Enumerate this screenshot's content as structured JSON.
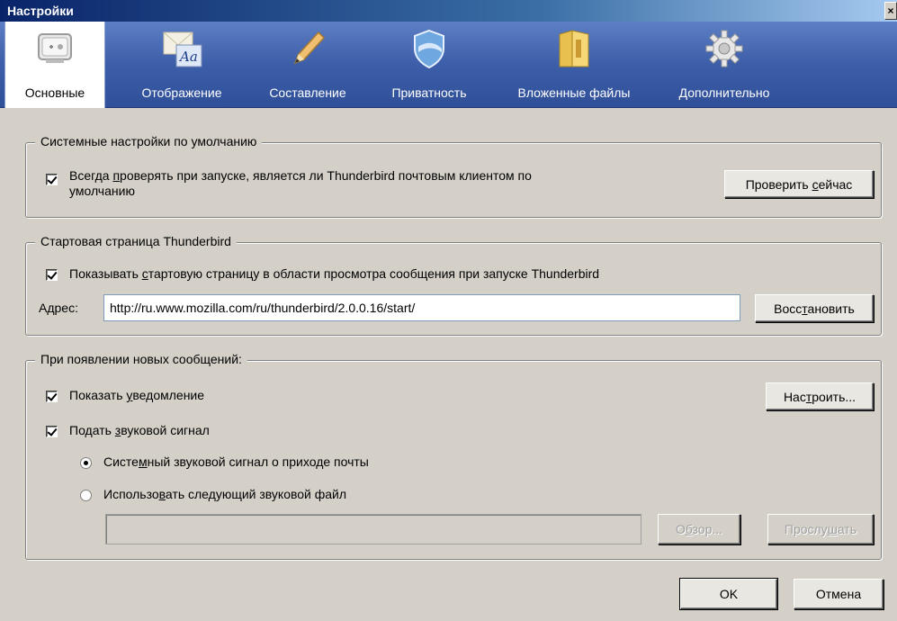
{
  "window": {
    "title": "Настройки"
  },
  "tabs": [
    {
      "label": "Основные",
      "icon": "general-icon"
    },
    {
      "label": "Отображение",
      "icon": "display-icon"
    },
    {
      "label": "Составление",
      "icon": "pencil-icon"
    },
    {
      "label": "Приватность",
      "icon": "shield-icon"
    },
    {
      "label": "Вложенные файлы",
      "icon": "folder-icon"
    },
    {
      "label": "Дополнительно",
      "icon": "gear-icon"
    }
  ],
  "default_system": {
    "legend": "Системные настройки по умолчанию",
    "check_pre": "Всегда ",
    "check_ul": "п",
    "check_post": "роверять при запуске, является ли Thunderbird почтовым клиентом по",
    "check_line2": "умолчанию",
    "check_button_pre": "Проверить ",
    "check_button_ul": "с",
    "check_button_post": "ейчас"
  },
  "start_page": {
    "legend": "Стартовая страница Thunderbird",
    "show_pre": "Показывать ",
    "show_ul": "с",
    "show_post": "тартовую страницу в области просмотра сообщения при запуске Thunderbird",
    "address_pre": "А",
    "address_ul": "д",
    "address_post": "рес:",
    "address_value": "http://ru.www.mozilla.com/ru/thunderbird/2.0.0.16/start/",
    "restore_pre": "Восс",
    "restore_ul": "т",
    "restore_post": "ановить"
  },
  "new_messages": {
    "legend": "При появлении новых сообщений:",
    "notify_pre": "Показать ",
    "notify_ul": "у",
    "notify_post": "ведомление",
    "configure_pre": "Нас",
    "configure_ul": "т",
    "configure_post": "роить...",
    "sound_pre": "Подать ",
    "sound_ul": "з",
    "sound_post": "вуковой сигнал",
    "radio_system_pre": "Систе",
    "radio_system_ul": "м",
    "radio_system_post": "ный звуковой сигнал о приходе почты",
    "radio_file_pre": "Использо",
    "radio_file_ul": "в",
    "radio_file_post": "ать следующий звуковой файл",
    "browse_pre": "О",
    "browse_ul": "б",
    "browse_post": "зор...",
    "listen_pre": "Прослу",
    "listen_ul": "ш",
    "listen_post": "ать"
  },
  "footer": {
    "ok": "OK",
    "cancel": "Отмена"
  },
  "colors": {
    "toolbar": "#3d5ea8",
    "dialog_bg": "#d4d0c8",
    "titlebar": "#0a246a"
  }
}
